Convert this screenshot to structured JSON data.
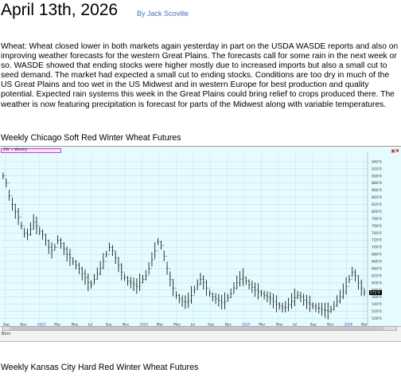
{
  "header": {
    "date": "April 13th, 2026",
    "author": "By Jack Scoville"
  },
  "article": {
    "wheat_paragraph": "Wheat:  Wheat closed lower in both markets again yesterday in part on the USDA WASDE reports and also on improving weather forecasts for the western Great Plains.  The forecasts call for some rain in the next week or so.  WASDE showed that ending stocks were higher mostly due to increased imports but also a small cut to seed demand.  The market had expected a small cut to ending stocks.  Conditions are too dry in much of the US Great Plains and too wet in the US Midwest and in western Europe for best production and quality potential.  Expected rain systems this week in the Great Plains could bring relief to crops produced there.  The weather is now featuring precipitation is forecast for parts of the Midwest along with variable temperatures."
  },
  "charts": {
    "chicago_title": "Weekly Chicago Soft Red Winter Wheat Futures",
    "kc_title": "Weekly Kansas City Hard Red Winter Wheat Futures",
    "symbol_box": "ZW = Weekly",
    "bars_label": "Bars",
    "last_price_label": "572'4",
    "colors": {
      "background": "#e6fbff",
      "bar": "#000000",
      "grid": "#b7dce6",
      "last_price_box": "#000000"
    }
  },
  "chart_data": {
    "type": "ohlc",
    "title": "",
    "xlabel": "",
    "ylabel": "",
    "ylim": [
      490,
      960
    ],
    "y_ticks": [
      "940'0",
      "920'0",
      "900'0",
      "880'0",
      "860'0",
      "840'0",
      "820'0",
      "800'0",
      "780'0",
      "760'0",
      "740'0",
      "720'0",
      "700'0",
      "680'0",
      "660'0",
      "640'0",
      "620'0",
      "600'0",
      "580'0",
      "560'0",
      "540'0",
      "520'0",
      "500'0"
    ],
    "x_tick_labels": [
      "Sep",
      "Nov",
      "2023",
      "Mar",
      "May",
      "Jul",
      "Sep",
      "Nov",
      "2024",
      "Mar",
      "May",
      "Jul",
      "Sep",
      "Nov",
      "2025",
      "Mar",
      "May",
      "Jul",
      "Sep",
      "Nov",
      "2026",
      "Mar"
    ],
    "grid": true,
    "last_value": 572.5,
    "series": [
      {
        "values": [
          900,
          880,
          845,
          820,
          800,
          785,
          760,
          740,
          735,
          750,
          770,
          760,
          745,
          735,
          720,
          700,
          690,
          700,
          720,
          710,
          695,
          680,
          670,
          660,
          650,
          640,
          625,
          615,
          600,
          595,
          610,
          625,
          640,
          660,
          680,
          700,
          690,
          670,
          650,
          630,
          615,
          605,
          600,
          595,
          590,
          600,
          610,
          620,
          640,
          665,
          690,
          715,
          705,
          675,
          640,
          610,
          585,
          565,
          555,
          548,
          545,
          550,
          565,
          580,
          595,
          610,
          600,
          585,
          570,
          560,
          555,
          550,
          545,
          548,
          558,
          570,
          585,
          600,
          610,
          615,
          605,
          595,
          588,
          580,
          575,
          570,
          565,
          560,
          555,
          548,
          540,
          535,
          530,
          532,
          538,
          548,
          558,
          565,
          560,
          552,
          545,
          540,
          535,
          530,
          528,
          525,
          522,
          520,
          525,
          535,
          548,
          560,
          575,
          590,
          610,
          630,
          620,
          600,
          585,
          572.5
        ]
      }
    ]
  }
}
